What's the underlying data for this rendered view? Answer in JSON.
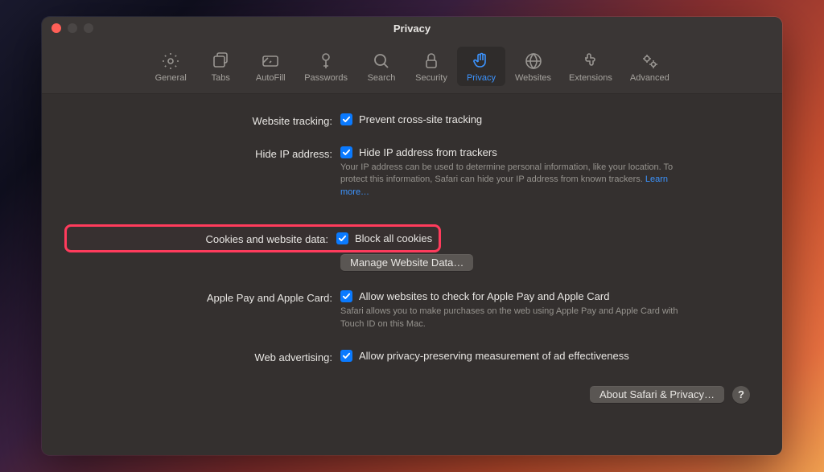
{
  "window": {
    "title": "Privacy"
  },
  "toolbar": {
    "tabs": [
      {
        "label": "General"
      },
      {
        "label": "Tabs"
      },
      {
        "label": "AutoFill"
      },
      {
        "label": "Passwords"
      },
      {
        "label": "Search"
      },
      {
        "label": "Security"
      },
      {
        "label": "Privacy"
      },
      {
        "label": "Websites"
      },
      {
        "label": "Extensions"
      },
      {
        "label": "Advanced"
      }
    ],
    "active_index": 6
  },
  "sections": {
    "website_tracking": {
      "label": "Website tracking:",
      "checkbox_label": "Prevent cross-site tracking"
    },
    "hide_ip": {
      "label": "Hide IP address:",
      "checkbox_label": "Hide IP address from trackers",
      "desc": "Your IP address can be used to determine personal information, like your location. To protect this information, Safari can hide your IP address from known trackers.",
      "learn_more": "Learn more…"
    },
    "cookies": {
      "label": "Cookies and website data:",
      "checkbox_label": "Block all cookies",
      "manage_button": "Manage Website Data…"
    },
    "apple_pay": {
      "label": "Apple Pay and Apple Card:",
      "checkbox_label": "Allow websites to check for Apple Pay and Apple Card",
      "desc": "Safari allows you to make purchases on the web using Apple Pay and Apple Card with Touch ID on this Mac."
    },
    "web_ads": {
      "label": "Web advertising:",
      "checkbox_label": "Allow privacy-preserving measurement of ad effectiveness"
    }
  },
  "footer": {
    "about_button": "About Safari & Privacy…",
    "help": "?"
  }
}
